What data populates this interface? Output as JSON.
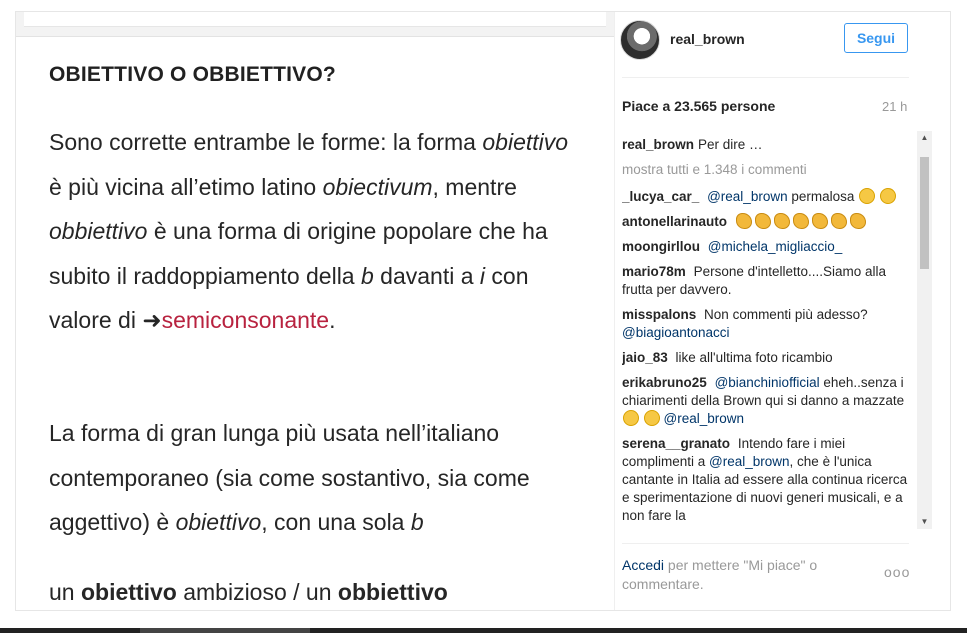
{
  "post_image": {
    "heading": "OBIETTIVO O OBBIETTIVO?",
    "paragraph1": [
      "Sono corrette entrambe le forme: la forma ",
      "obiettivo",
      " è più vicina all’etimo latino ",
      "obiectivum",
      ", mentre ",
      "obbiettivo",
      " è una forma di origine popolare che ha subito il raddoppiamento della ",
      "b",
      " davanti a ",
      "i",
      " con valore di ",
      "➜",
      "semiconsonante",
      "."
    ],
    "paragraph2": [
      "La forma di gran lunga più usata nell’italiano contemporaneo (sia come sostantivo, sia come aggettivo) è ",
      "obiettivo",
      ", con una sola ",
      "b"
    ],
    "paragraph3": [
      "un ",
      "obiettivo",
      " ambizioso / un ",
      "obbiettivo"
    ]
  },
  "header": {
    "username": "real_brown",
    "follow_label": "Segui"
  },
  "likes_text": "Piace a 23.565 persone",
  "timestamp": "21 h",
  "caption": {
    "user": "real_brown",
    "text": "Per dire …"
  },
  "show_all_comments": "mostra tutti e 1.348 i commenti",
  "comments": [
    {
      "user": "_lucya_car_",
      "mention": "@real_brown",
      "text": "permalosa",
      "emoji": [
        "face-with-tears-of-joy",
        "face-with-tears-of-joy"
      ]
    },
    {
      "user": "antonellarinauto",
      "emoji": [
        "clapping-hands",
        "clapping-hands",
        "clapping-hands",
        "clapping-hands",
        "clapping-hands",
        "clapping-hands",
        "clapping-hands"
      ]
    },
    {
      "user": "moongirllou",
      "mention": "@michela_migliaccio_"
    },
    {
      "user": "mario78m",
      "text": "Persone d'intelletto....Siamo alla frutta per davvero."
    },
    {
      "user": "misspalons",
      "text": "Non commenti più adesso?",
      "mention2": "@biagioantonacci"
    },
    {
      "user": "jaio_83",
      "text": "like all'ultima foto ricambio"
    },
    {
      "user": "erikabruno25",
      "mention": "@bianchiniofficial",
      "text": "eheh..senza i chiarimenti della Brown qui si danno a mazzate",
      "emoji": [
        "face-with-tears-of-joy",
        "face-with-tears-of-joy"
      ],
      "mention2": "@real_brown"
    },
    {
      "user": "serena__granato",
      "text": "Intendo fare i miei complimenti a",
      "mention2": "@real_brown",
      "text2": ", che è l'unica cantante in Italia ad essere alla continua ricerca e sperimentazione di nuovi generi musicali, e a non fare la"
    }
  ],
  "footer": {
    "login_link": "Accedi",
    "text": " per mettere \"Mi piace\" o commentare.",
    "more_label": "ooo"
  },
  "icons": {
    "scroll_up": "▲",
    "scroll_down": "▼"
  },
  "colors": {
    "accent": "#3897f0",
    "link": "#003569",
    "muted": "#999999",
    "highlight_link": "#b8223f"
  }
}
